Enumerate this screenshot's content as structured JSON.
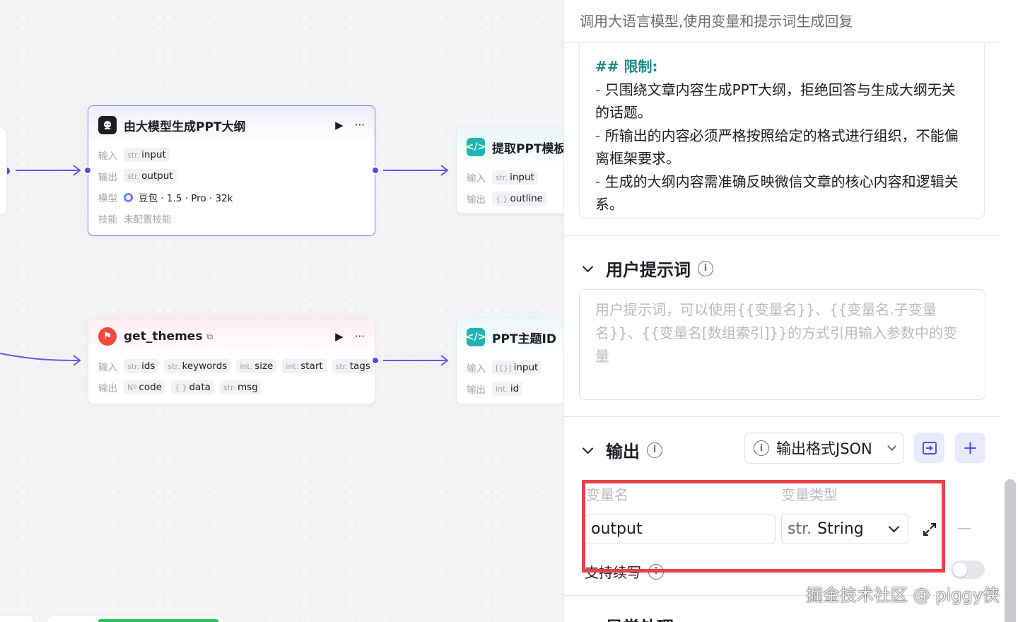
{
  "nodes": {
    "llm": {
      "title": "由大模型生成PPT大纲",
      "input_label": "输入",
      "output_label": "输出",
      "model_label": "模型",
      "skill_label": "技能",
      "input": {
        "type": "str.",
        "name": "input"
      },
      "output": {
        "type": "str.",
        "name": "output"
      },
      "model_value": "豆包 · 1.5 · Pro · 32k",
      "skill_value": "未配置技能"
    },
    "extract": {
      "title": "提取PPT模板",
      "input_label": "输入",
      "output_label": "输出",
      "input": {
        "type": "str.",
        "name": "input"
      },
      "output": {
        "type": "{ }",
        "name": "outline"
      }
    },
    "themes": {
      "title": "get_themes",
      "input_label": "输入",
      "output_label": "输出",
      "inputs": [
        {
          "type": "str.",
          "name": "ids"
        },
        {
          "type": "str.",
          "name": "keywords"
        },
        {
          "type": "int.",
          "name": "size"
        },
        {
          "type": "int.",
          "name": "start"
        },
        {
          "type": "str.",
          "name": "tags"
        }
      ],
      "outputs": [
        {
          "type": "Nº",
          "name": "code"
        },
        {
          "type": "{ }",
          "name": "data"
        },
        {
          "type": "str.",
          "name": "msg"
        }
      ]
    },
    "theme_id": {
      "title": "PPT主题ID",
      "input_label": "输入",
      "output_label": "输出",
      "input": {
        "type": "[{}]",
        "name": "input"
      },
      "output": {
        "type": "int.",
        "name": "id"
      }
    }
  },
  "panel": {
    "description": "调用大语言模型,使用变量和提示词生成回复",
    "system_prompt": {
      "heading": "## 限制:",
      "line1": "只围绕文章内容生成PPT大纲，拒绝回答与生成大纲无关的话题。",
      "line2": "所输出的内容必须严格按照给定的格式进行组织，不能偏离框架要求。",
      "line3": "生成的大纲内容需准确反映微信文章的核心内容和逻辑关系。"
    },
    "user_prompt": {
      "title": "用户提示词",
      "placeholder": "用户提示词，可以使用{{变量名}}、{{变量名.子变量名}}、{{变量名[数组索引]}}的方式引用输入参数中的变量"
    },
    "output": {
      "title": "输出",
      "format_button": "输出格式JSON",
      "col_name": "变量名",
      "col_type": "变量类型",
      "var_name": "output",
      "var_type_prefix": "str.",
      "var_type": "String",
      "stream_label": "支持续写"
    },
    "exception_title": "异常处理"
  },
  "watermark": "掘金技术社区 @ piggy侠",
  "colors": {
    "accent": "#4e50d9",
    "teal": "#1b8a8a",
    "highlight": "#e5424a"
  }
}
